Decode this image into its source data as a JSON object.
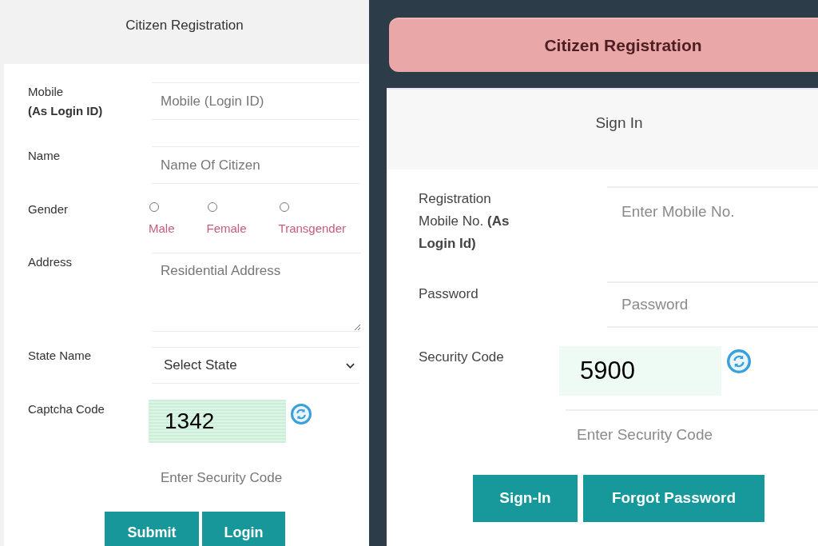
{
  "registration_form": {
    "title": "Citizen Registration",
    "fields": [
      {
        "kind": "text",
        "label": "Mobile\n**(As Login ID)**",
        "placeholder": "Mobile (Login ID)"
      },
      {
        "kind": "text",
        "label": "Name",
        "placeholder": "Name Of Citizen"
      },
      {
        "kind": "radio",
        "label": "Gender",
        "options": [
          {
            "label": "Male",
            "selected": false
          },
          {
            "label": "Female",
            "selected": false
          },
          {
            "label": "Transgender",
            "selected": false
          }
        ]
      },
      {
        "kind": "textarea",
        "label": "Address",
        "placeholder": "Residential Address"
      },
      {
        "kind": "select",
        "label": "State Name",
        "value": "Select State"
      },
      {
        "kind": "captcha",
        "label": "Captcha Code",
        "code": "1342"
      },
      {
        "kind": "text",
        "placeholder": "Enter Security Code"
      }
    ],
    "buttons": [
      {
        "label": "Submit"
      },
      {
        "label": "Login"
      }
    ]
  },
  "sign_in_form": {
    "banner_title": "Citizen Registration",
    "title": "Sign In",
    "fields": [
      {
        "kind": "text",
        "label": "Registration Mobile No. **(As Login Id)**",
        "placeholder": "Enter Mobile No."
      },
      {
        "kind": "password",
        "label": "Password",
        "placeholder": "Password"
      },
      {
        "kind": "captcha",
        "label": "Security Code",
        "code": "5900"
      },
      {
        "kind": "text",
        "placeholder": "Enter Security Code"
      }
    ],
    "buttons": [
      {
        "label": "Sign-In"
      },
      {
        "label": "Forgot Password"
      }
    ]
  }
}
